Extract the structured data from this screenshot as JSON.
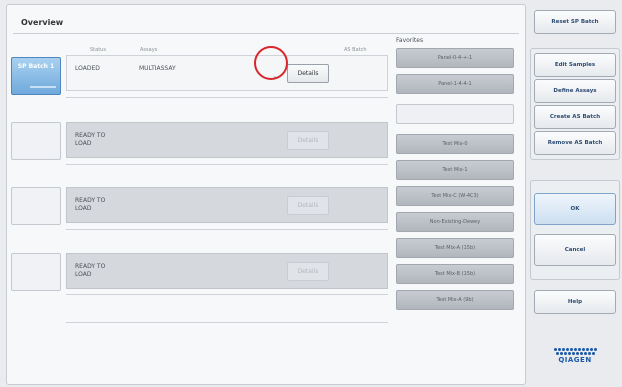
{
  "overview": {
    "title": "Overview"
  },
  "slots": [
    {
      "label": "SP Batch 1",
      "active": true
    },
    {
      "label": "",
      "active": false
    },
    {
      "label": "",
      "active": false
    },
    {
      "label": "",
      "active": false
    }
  ],
  "columns": {
    "status": "Status",
    "assays": "Assays",
    "as_batch": "AS Batch"
  },
  "batches": [
    {
      "status": "LOADED",
      "assay": "MULTIASSAY",
      "details_label": "Details",
      "details_enabled": true
    },
    {
      "status": "READY TO LOAD",
      "assay": "",
      "details_label": "Details",
      "details_enabled": false
    },
    {
      "status": "READY TO LOAD",
      "assay": "",
      "details_label": "Details",
      "details_enabled": false
    },
    {
      "status": "READY TO LOAD",
      "assay": "",
      "details_label": "Details",
      "details_enabled": false
    }
  ],
  "favorites": {
    "label": "Favorites",
    "items": [
      "Panel-0-4-+-1",
      "Panel-1-4-4-1",
      "",
      "Test Mix-0",
      "Test Mix-1",
      "Test Mix-C (W-4C3)",
      "Non-Existing-Dewey",
      "Test Mix-A (15b)",
      "Test Mix-B (15b)",
      "Test Mix-A (9b)"
    ]
  },
  "actions": {
    "reset": "Reset SP Batch",
    "edit_samples": "Edit Samples",
    "define_assays": "Define Assays",
    "create_as_batch": "Create AS Batch",
    "remove_as_batch": "Remove AS Batch",
    "ok": "OK",
    "cancel": "Cancel",
    "help": "Help"
  },
  "brand": {
    "name": "QIAGEN",
    "color": "#1c5aa8"
  },
  "colors": {
    "accent": "#6fa9dc",
    "highlight": "#d8262c"
  }
}
